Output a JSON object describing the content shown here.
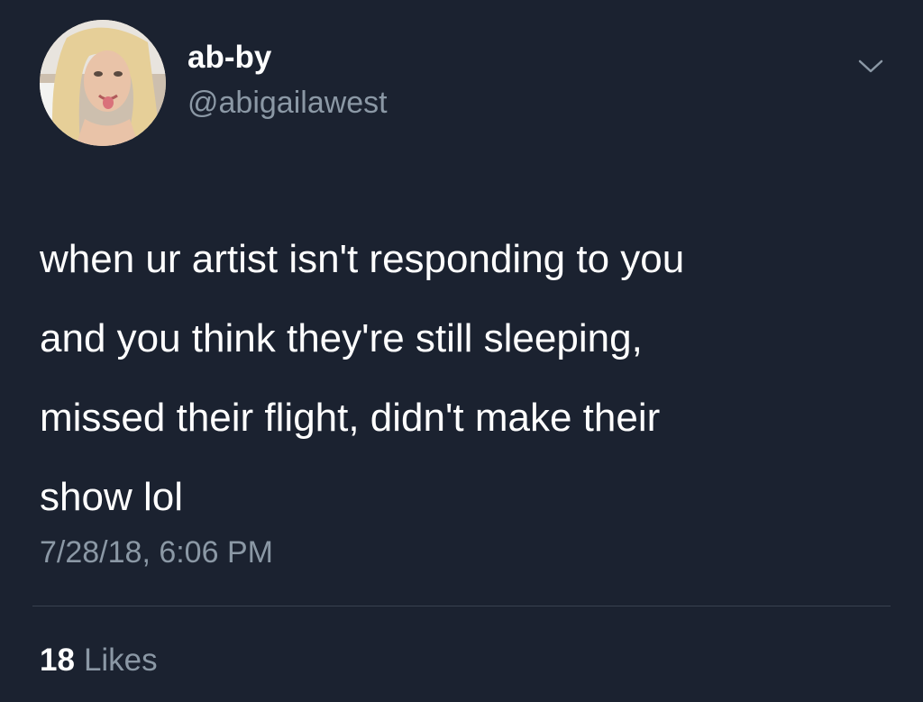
{
  "author": {
    "display_name": "ab-by",
    "handle": "@abigailawest"
  },
  "tweet": {
    "text_lines": [
      "when ur artist isn't responding to you",
      "and you think they're still sleeping,",
      "missed their flight, didn't make their",
      "show lol"
    ],
    "timestamp": "7/28/18, 6:06 PM"
  },
  "engagement": {
    "likes_count": "18",
    "likes_label": "Likes"
  },
  "icons": {
    "menu": "chevron-down-icon"
  },
  "colors": {
    "background": "#1b2230",
    "primary_text": "#ffffff",
    "secondary_text": "#8b98a5",
    "divider": "#39424f"
  }
}
